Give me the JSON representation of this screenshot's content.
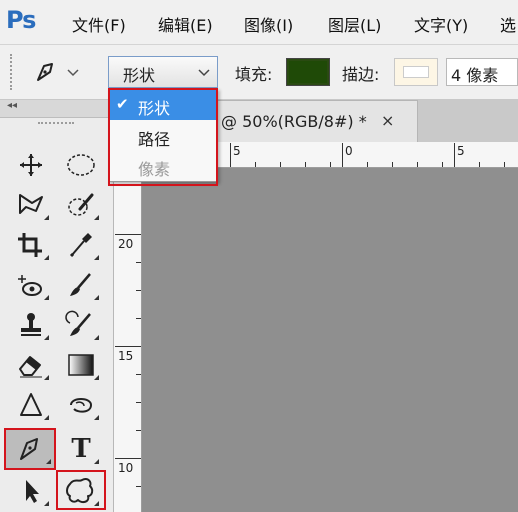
{
  "app": {
    "logo": "Ps"
  },
  "menu": [
    {
      "id": "file",
      "label": "文件(F)"
    },
    {
      "id": "edit",
      "label": "编辑(E)"
    },
    {
      "id": "image",
      "label": "图像(I)"
    },
    {
      "id": "layer",
      "label": "图层(L)"
    },
    {
      "id": "type",
      "label": "文字(Y)"
    },
    {
      "id": "select",
      "label": "选"
    }
  ],
  "options_bar": {
    "mode_value": "形状",
    "mode_options": [
      {
        "label": "形状",
        "checked": true,
        "enabled": true
      },
      {
        "label": "路径",
        "checked": false,
        "enabled": true
      },
      {
        "label": "像素",
        "checked": false,
        "enabled": false
      }
    ],
    "fill_label": "填充:",
    "fill_color": "#1f4a07",
    "stroke_label": "描边:",
    "stroke_color": "#fdf6e5",
    "stroke_width": "4 像素"
  },
  "document": {
    "tab_title": "@ 50%(RGB/8#) *",
    "close_glyph": "×",
    "canvas_color": "#8f8f8f",
    "ruler_top_labels": [
      "5",
      "0",
      "5"
    ],
    "ruler_left_labels": [
      "20",
      "15",
      "10"
    ]
  },
  "toolbox": {
    "collapse_glyph": "◂◂",
    "tools": [
      {
        "name": "move-tool"
      },
      {
        "name": "elliptical-marquee-tool"
      },
      {
        "name": "polygonal-lasso-tool"
      },
      {
        "name": "quick-selection-tool"
      },
      {
        "name": "crop-tool"
      },
      {
        "name": "eyedropper-tool"
      },
      {
        "name": "spot-healing-tool"
      },
      {
        "name": "brush-tool"
      },
      {
        "name": "clone-stamp-tool"
      },
      {
        "name": "history-brush-tool"
      },
      {
        "name": "eraser-tool"
      },
      {
        "name": "gradient-tool"
      },
      {
        "name": "blur-tool"
      },
      {
        "name": "dodge-tool"
      },
      {
        "name": "pen-tool"
      },
      {
        "name": "type-tool",
        "glyph": "T"
      },
      {
        "name": "path-selection-tool"
      },
      {
        "name": "custom-shape-tool"
      }
    ]
  },
  "annotations": {
    "color": "#d4141c"
  }
}
